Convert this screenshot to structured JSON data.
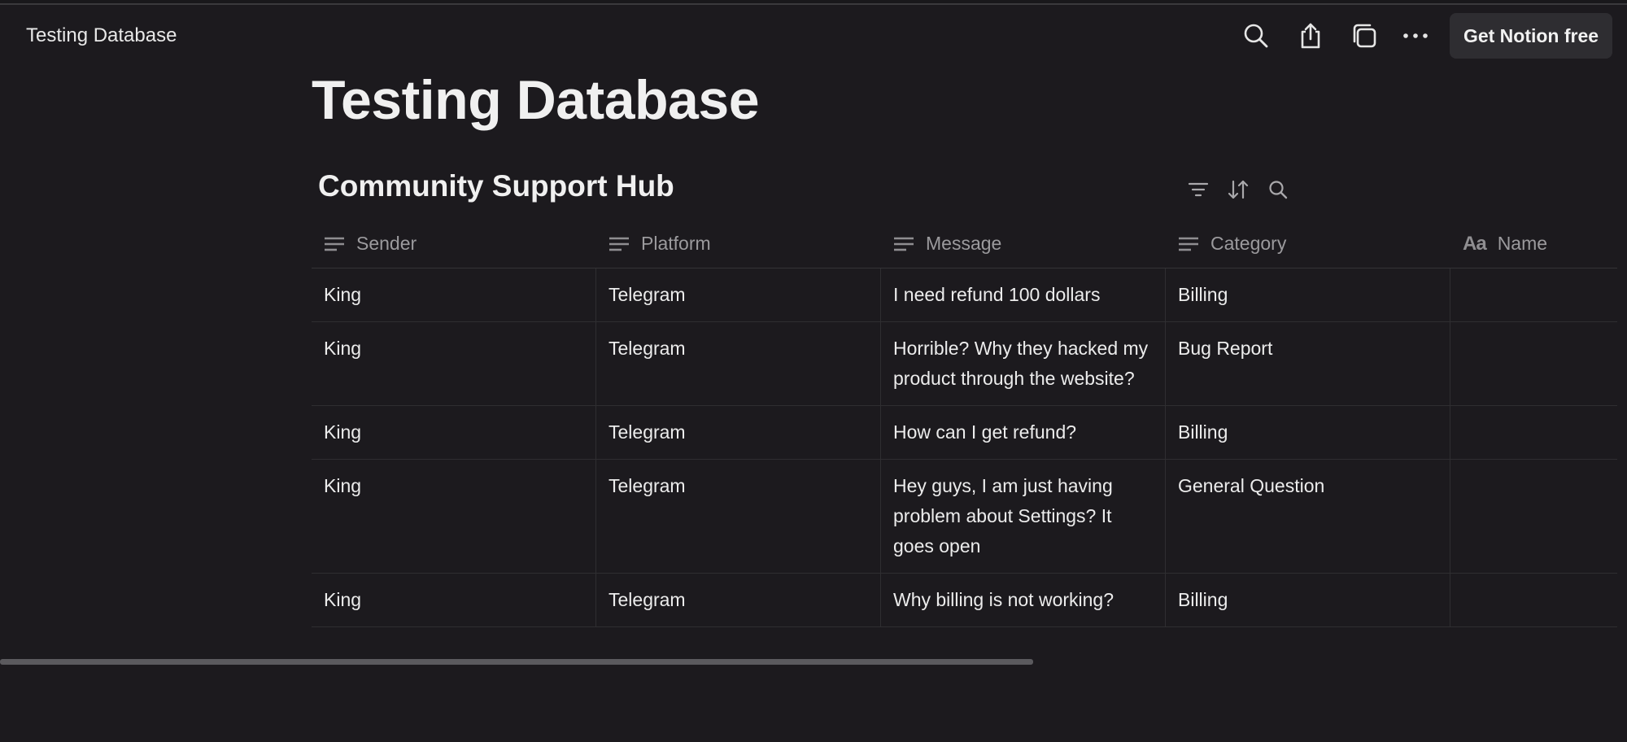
{
  "topbar": {
    "breadcrumb": "Testing Database",
    "icons": [
      "search-icon",
      "share-icon",
      "duplicate-icon",
      "more-icon"
    ],
    "cta_label": "Get Notion free"
  },
  "page": {
    "title": "Testing Database"
  },
  "database": {
    "title": "Community Support Hub",
    "tools": [
      "filter-icon",
      "sort-icon",
      "search-icon"
    ],
    "columns": [
      {
        "label": "Sender",
        "type_icon": "text-lines-icon"
      },
      {
        "label": "Platform",
        "type_icon": "text-lines-icon"
      },
      {
        "label": "Message",
        "type_icon": "text-lines-icon"
      },
      {
        "label": "Category",
        "type_icon": "text-lines-icon"
      },
      {
        "label": "Name",
        "type_icon": "title-aa-icon",
        "type_glyph": "Aa"
      }
    ],
    "rows": [
      {
        "sender": "King",
        "platform": "Telegram",
        "message": "I need refund 100 dollars",
        "category": "Billing",
        "name": ""
      },
      {
        "sender": "King",
        "platform": "Telegram",
        "message": "Horrible? Why they hacked my product through the website?",
        "category": "Bug Report",
        "name": ""
      },
      {
        "sender": "King",
        "platform": "Telegram",
        "message": "How can I get refund?",
        "category": "Billing",
        "name": ""
      },
      {
        "sender": "King",
        "platform": "Telegram",
        "message": "Hey guys, I am just having problem about Settings? It goes open",
        "category": "General Question",
        "name": ""
      },
      {
        "sender": "King",
        "platform": "Telegram",
        "message": "Why billing is not working?",
        "category": "Billing",
        "name": ""
      }
    ]
  },
  "colors": {
    "background": "#1c1a1e",
    "button_bg": "#2e2d31",
    "text": "#ececec",
    "muted": "#9b9a9d"
  }
}
